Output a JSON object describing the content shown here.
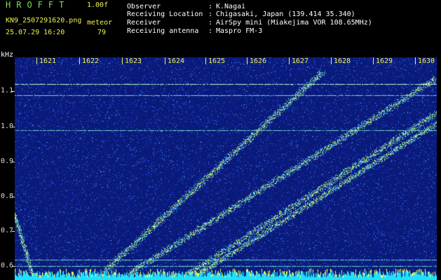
{
  "header": {
    "app_title": "HROFFT",
    "version": "1.00f",
    "filename": "KN9_2507291620.png",
    "timestamp": "25.07.29 16:20",
    "meteor_label": "meteor",
    "meteor_count": "79"
  },
  "info": [
    {
      "label": "Observer",
      "value": "K.Nagai"
    },
    {
      "label": "Receiving Location",
      "value": "Chigasaki, Japan (139.414 35.340)"
    },
    {
      "label": "Receiver",
      "value": "AirSpy mini (Miakejima VOR 108.65MHz)"
    },
    {
      "label": "Receiving antenna",
      "value": "Maspro FM-3"
    }
  ],
  "axis": {
    "y_unit": "kHz",
    "y_ticks": [
      "1.1",
      "1.0",
      "0.9",
      "0.8",
      "0.7",
      "0.6"
    ],
    "x_ticks": [
      "1621",
      "1622",
      "1623",
      "1624",
      "1625",
      "1626",
      "1627",
      "1628",
      "1629",
      "1630"
    ]
  },
  "colors": {
    "background": "#000000",
    "spectro_bg": "#0a1a7a",
    "noise": "#2f6fff",
    "signal": "#8fe0a0",
    "hot": "#ffff40",
    "header_green": "#7fe04f",
    "header_yellow": "#f2f24a"
  }
}
